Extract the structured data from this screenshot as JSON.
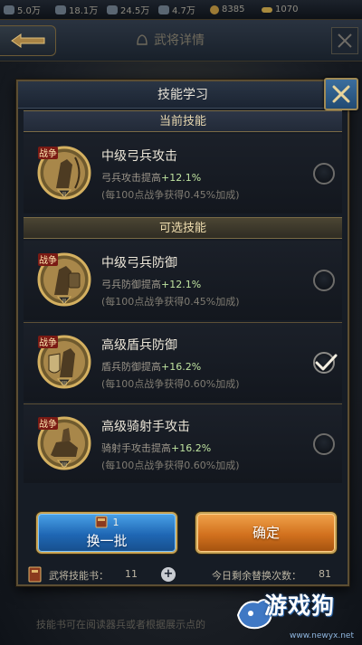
{
  "resources": [
    {
      "icon": "stone-icon",
      "value": "5.0万"
    },
    {
      "icon": "wood-icon",
      "value": "18.1万"
    },
    {
      "icon": "iron-icon",
      "value": "24.5万"
    },
    {
      "icon": "grain-icon",
      "value": "4.7万"
    },
    {
      "icon": "coin-icon",
      "value": "8385"
    },
    {
      "icon": "gold-bar-icon",
      "value": "1070"
    }
  ],
  "background": {
    "title": "武将详情",
    "footer_text": "技能书可在阅读器兵或者根据展示点的"
  },
  "dialog": {
    "title": "技能学习",
    "current_section": "当前技能",
    "optional_section": "可选技能",
    "current_skill": {
      "name": "中级弓兵攻击",
      "desc_prefix": "弓兵攻击提高",
      "desc_value": "+12.1%",
      "note": "(每100点战争获得0.45%加成)",
      "rank": "II",
      "selected": false
    },
    "optional_skills": [
      {
        "name": "中级弓兵防御",
        "desc_prefix": "弓兵防御提高",
        "desc_value": "+12.1%",
        "note": "(每100点战争获得0.45%加成)",
        "rank": "II",
        "selected": false
      },
      {
        "name": "高级盾兵防御",
        "desc_prefix": "盾兵防御提高",
        "desc_value": "+16.2%",
        "note": "(每100点战争获得0.60%加成)",
        "rank": "III",
        "selected": true
      },
      {
        "name": "高级骑射手攻击",
        "desc_prefix": "骑射手攻击提高",
        "desc_value": "+16.2%",
        "note": "(每100点战争获得0.60%加成)",
        "rank": "III",
        "selected": false
      }
    ],
    "skill_badge": "战争",
    "swap_button": {
      "cost": "1",
      "label": "换一批"
    },
    "confirm_button": "确定",
    "info": {
      "book_label": "武将技能书：",
      "book_count": "11",
      "remaining_label": "今日剩余替换次数：",
      "remaining_count": "81"
    }
  },
  "watermark": {
    "text": "游戏狗",
    "url": "www.newyx.net"
  },
  "colors": {
    "accent_gold": "#c9a557",
    "swap_blue": "#1f67b4",
    "confirm_orange": "#d2711e",
    "bonus_green": "#bfe3a0"
  }
}
